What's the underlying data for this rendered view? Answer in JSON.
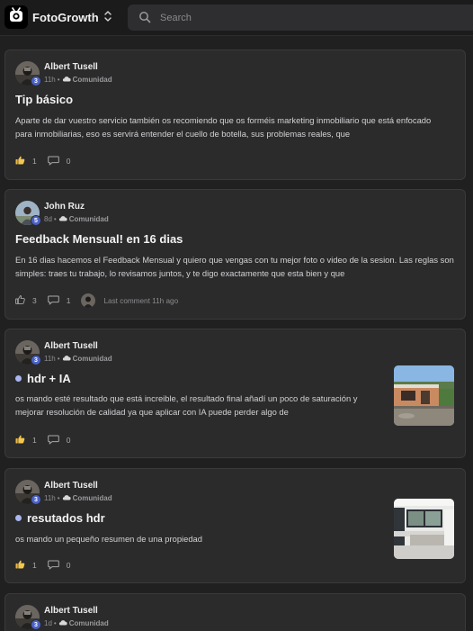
{
  "app": {
    "name": "FotoGrowth",
    "logo_icon": "camera-badge-icon",
    "switcher_icon": "chevron-up-down-icon"
  },
  "search": {
    "placeholder": "Search",
    "value": ""
  },
  "colors": {
    "background": "#202021",
    "card": "#2b2b2c",
    "level_badge": "#4a62c8",
    "unread_dot": "#a9b7ef"
  },
  "posts": [
    {
      "author": "Albert Tusell",
      "level": "3",
      "time": "11h",
      "separator": "•",
      "category": "Comunidad",
      "unread": false,
      "title": "Tip básico",
      "excerpt": "Aparte de dar vuestro servicio también os recomiendo que os forméis marketing inmobiliario que está enfocado para inmobiliarias, eso es servirá entender el cuello de botella, sus problemas reales, que",
      "likes": "1",
      "liked": true,
      "comments": "0"
    },
    {
      "author": "John Ruz",
      "level": "5",
      "time": "8d",
      "separator": "•",
      "category": "Comunidad",
      "unread": false,
      "title": "Feedback Mensual! en 16 dias",
      "excerpt": "En 16 dias hacemos el Feedback Mensual y quiero que vengas con tu mejor foto o video de la sesion. Las reglas son simples: traes tu trabajo, lo revisamos juntos, y te digo exactamente que esta bien y que",
      "likes": "3",
      "liked": false,
      "comments": "1",
      "last_comment": "Last comment 11h ago"
    },
    {
      "author": "Albert Tusell",
      "level": "3",
      "time": "11h",
      "separator": "•",
      "category": "Comunidad",
      "unread": true,
      "title": "hdr + IA",
      "excerpt": "os mando esté resultado que está increible, el resultado final añadí un poco de saturación y mejorar resolución de calidad ya que aplicar con IA puede perder algo de",
      "likes": "1",
      "liked": true,
      "comments": "0",
      "thumbnail": "house-exterior-photo"
    },
    {
      "author": "Albert Tusell",
      "level": "3",
      "time": "11h",
      "separator": "•",
      "category": "Comunidad",
      "unread": true,
      "title": "resutados hdr",
      "excerpt": "os mando un pequeño resumen de una propiedad",
      "likes": "1",
      "liked": true,
      "comments": "0",
      "thumbnail": "kitchen-interior-photo"
    },
    {
      "author": "Albert Tusell",
      "level": "3",
      "time": "1d",
      "separator": "•",
      "category": "Comunidad"
    }
  ]
}
